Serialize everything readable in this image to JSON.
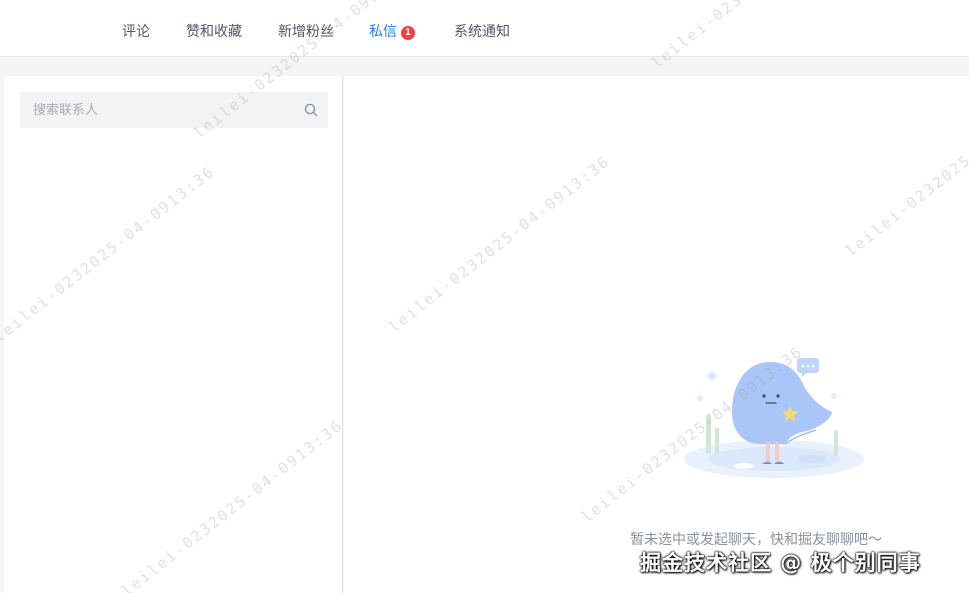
{
  "nav": {
    "items": [
      {
        "label": "评论"
      },
      {
        "label": "赞和收藏"
      },
      {
        "label": "新增粉丝"
      },
      {
        "label": "私信",
        "badge": "1",
        "active": true
      },
      {
        "label": "系统通知"
      }
    ]
  },
  "search": {
    "placeholder": "搜索联系人",
    "icon": "search-icon"
  },
  "chat": {
    "empty_text": "暂未选中或发起聊天，快和掘友聊聊吧～",
    "illustration_icon": "ghost-mascot-icon"
  },
  "brand_mark": "掘金技术社区 @ 极个别同事",
  "watermark": "leilei-0232025-04-0913:36",
  "colors": {
    "accent": "#1e80ff",
    "badge": "#f53f3f",
    "mascot": "#a8c6f7"
  }
}
